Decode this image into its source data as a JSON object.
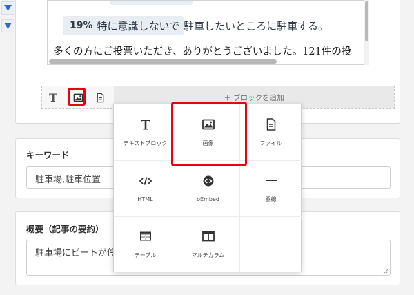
{
  "sidebar_arrows": [
    {
      "icon": "triangle-down-icon"
    },
    {
      "icon": "triangle-down-icon"
    }
  ],
  "preview": {
    "result_percent": "19%",
    "result_text_in_bar": "特に意識しないで",
    "result_text_rest": "駐車したいところに駐車する。",
    "paragraph": "多くの方にご投票いただき、ありがとうございました。121件の投"
  },
  "toolbar": {
    "icons": [
      "text-block-icon",
      "image-icon",
      "file-icon"
    ],
    "add_block_label": "＋ ブロックを追加"
  },
  "keyword_section": {
    "label": "キーワード",
    "value": "駐車場,駐車位置"
  },
  "summary_section": {
    "label": "概要（記事の要約）",
    "value": "駐車場にビートが停"
  },
  "block_menu": {
    "items": [
      {
        "label": "テキストブロック",
        "icon": "text-block-icon"
      },
      {
        "label": "画像",
        "icon": "image-icon"
      },
      {
        "label": "ファイル",
        "icon": "file-icon"
      },
      {
        "label": "HTML",
        "icon": "code-icon"
      },
      {
        "label": "oEmbed",
        "icon": "embed-icon"
      },
      {
        "label": "罫線",
        "icon": "horizontal-rule-icon"
      },
      {
        "label": "テーブル",
        "icon": "table-icon"
      },
      {
        "label": "マルチカラム",
        "icon": "multi-column-icon"
      }
    ]
  },
  "colors": {
    "highlight": "#e50012",
    "arrow": "#2e6bbf",
    "bar": "#e8edf4"
  }
}
